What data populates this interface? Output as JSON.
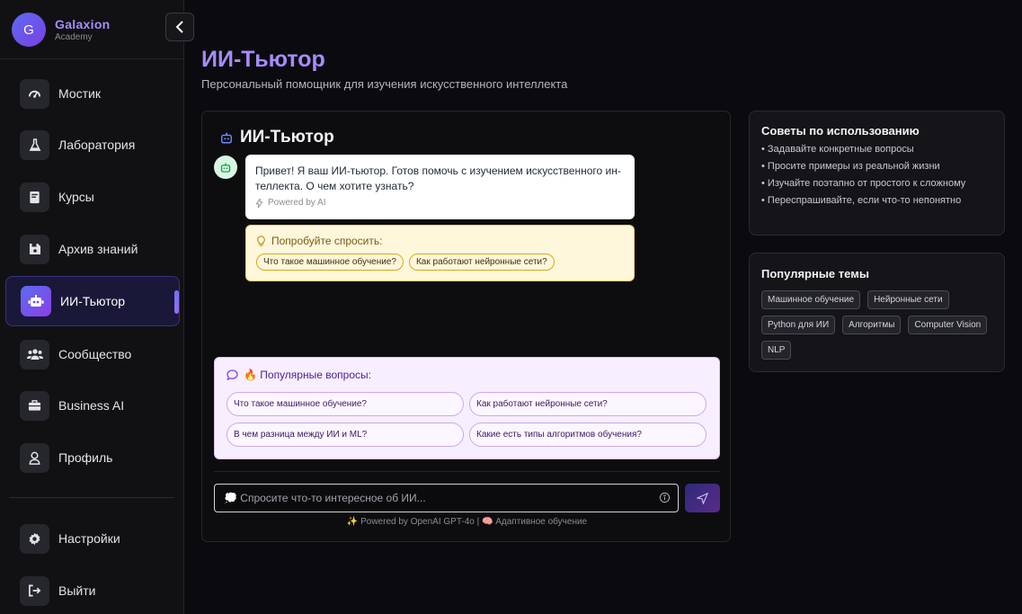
{
  "brand": {
    "initial": "G",
    "title": "Galaxion",
    "subtitle": "Academy"
  },
  "sidebar": {
    "items": [
      {
        "label": "Мостик",
        "icon": "gauge-icon"
      },
      {
        "label": "Лаборатория",
        "icon": "flask-icon"
      },
      {
        "label": "Курсы",
        "icon": "book-icon"
      },
      {
        "label": "Архив знаний",
        "icon": "save-icon"
      },
      {
        "label": "ИИ-Тьютор",
        "icon": "robot-icon",
        "active": true
      },
      {
        "label": "Сообщество",
        "icon": "users-icon"
      },
      {
        "label": "Business AI",
        "icon": "briefcase-icon"
      },
      {
        "label": "Профиль",
        "icon": "user-icon"
      }
    ],
    "bottom": [
      {
        "label": "Настройки",
        "icon": "gear-icon"
      },
      {
        "label": "Выйти",
        "icon": "logout-icon"
      }
    ]
  },
  "header": {
    "title": "ИИ-Тьютор",
    "subtitle": "Персональный помощник для изучения искусственного интеллекта"
  },
  "chat": {
    "title": "ИИ-Тьютор",
    "message": "Привет! Я ваш ИИ-тьютор. Готов помочь с изучением искусственного ин-теллекта. О чем хотите узнать?",
    "message_meta": "Powered by AI",
    "suggest_title": "Попробуйте спросить:",
    "suggest_chips": [
      "Что такое машинное обучение?",
      "Как работают нейронные сети?"
    ],
    "popular_title": "🔥 Популярные вопросы:",
    "popular_questions": [
      "Что такое машинное обучение?",
      "Как работают нейронные сети?",
      "В чем разница между ИИ и ML?",
      "Какие есть типы алгоритмов обучения?"
    ],
    "input_placeholder": "💭 Спросите что-то интересное об ИИ...",
    "footer": "✨ Powered by OpenAI GPT-4o | 🧠 Адаптивное обучение"
  },
  "tips": {
    "title": "Советы по использованию",
    "items": [
      "• Задавайте конкретные вопросы",
      "• Просите примеры из реальной жизни",
      "• Изучайте поэтапно от простого к сложному",
      "• Переспрашивайте, если что-то непонятно"
    ]
  },
  "topics": {
    "title": "Популярные темы",
    "tags": [
      "Машинное обучение",
      "Нейронные сети",
      "Python для ИИ",
      "Алгоритмы",
      "Computer Vision",
      "NLP"
    ]
  },
  "colors": {
    "accent": "#a78bfa",
    "active_bg": "#1a1838",
    "bubble_bg": "#ffffff",
    "suggest_bg": "#fff7dc",
    "popular_bg": "#f7efff"
  }
}
